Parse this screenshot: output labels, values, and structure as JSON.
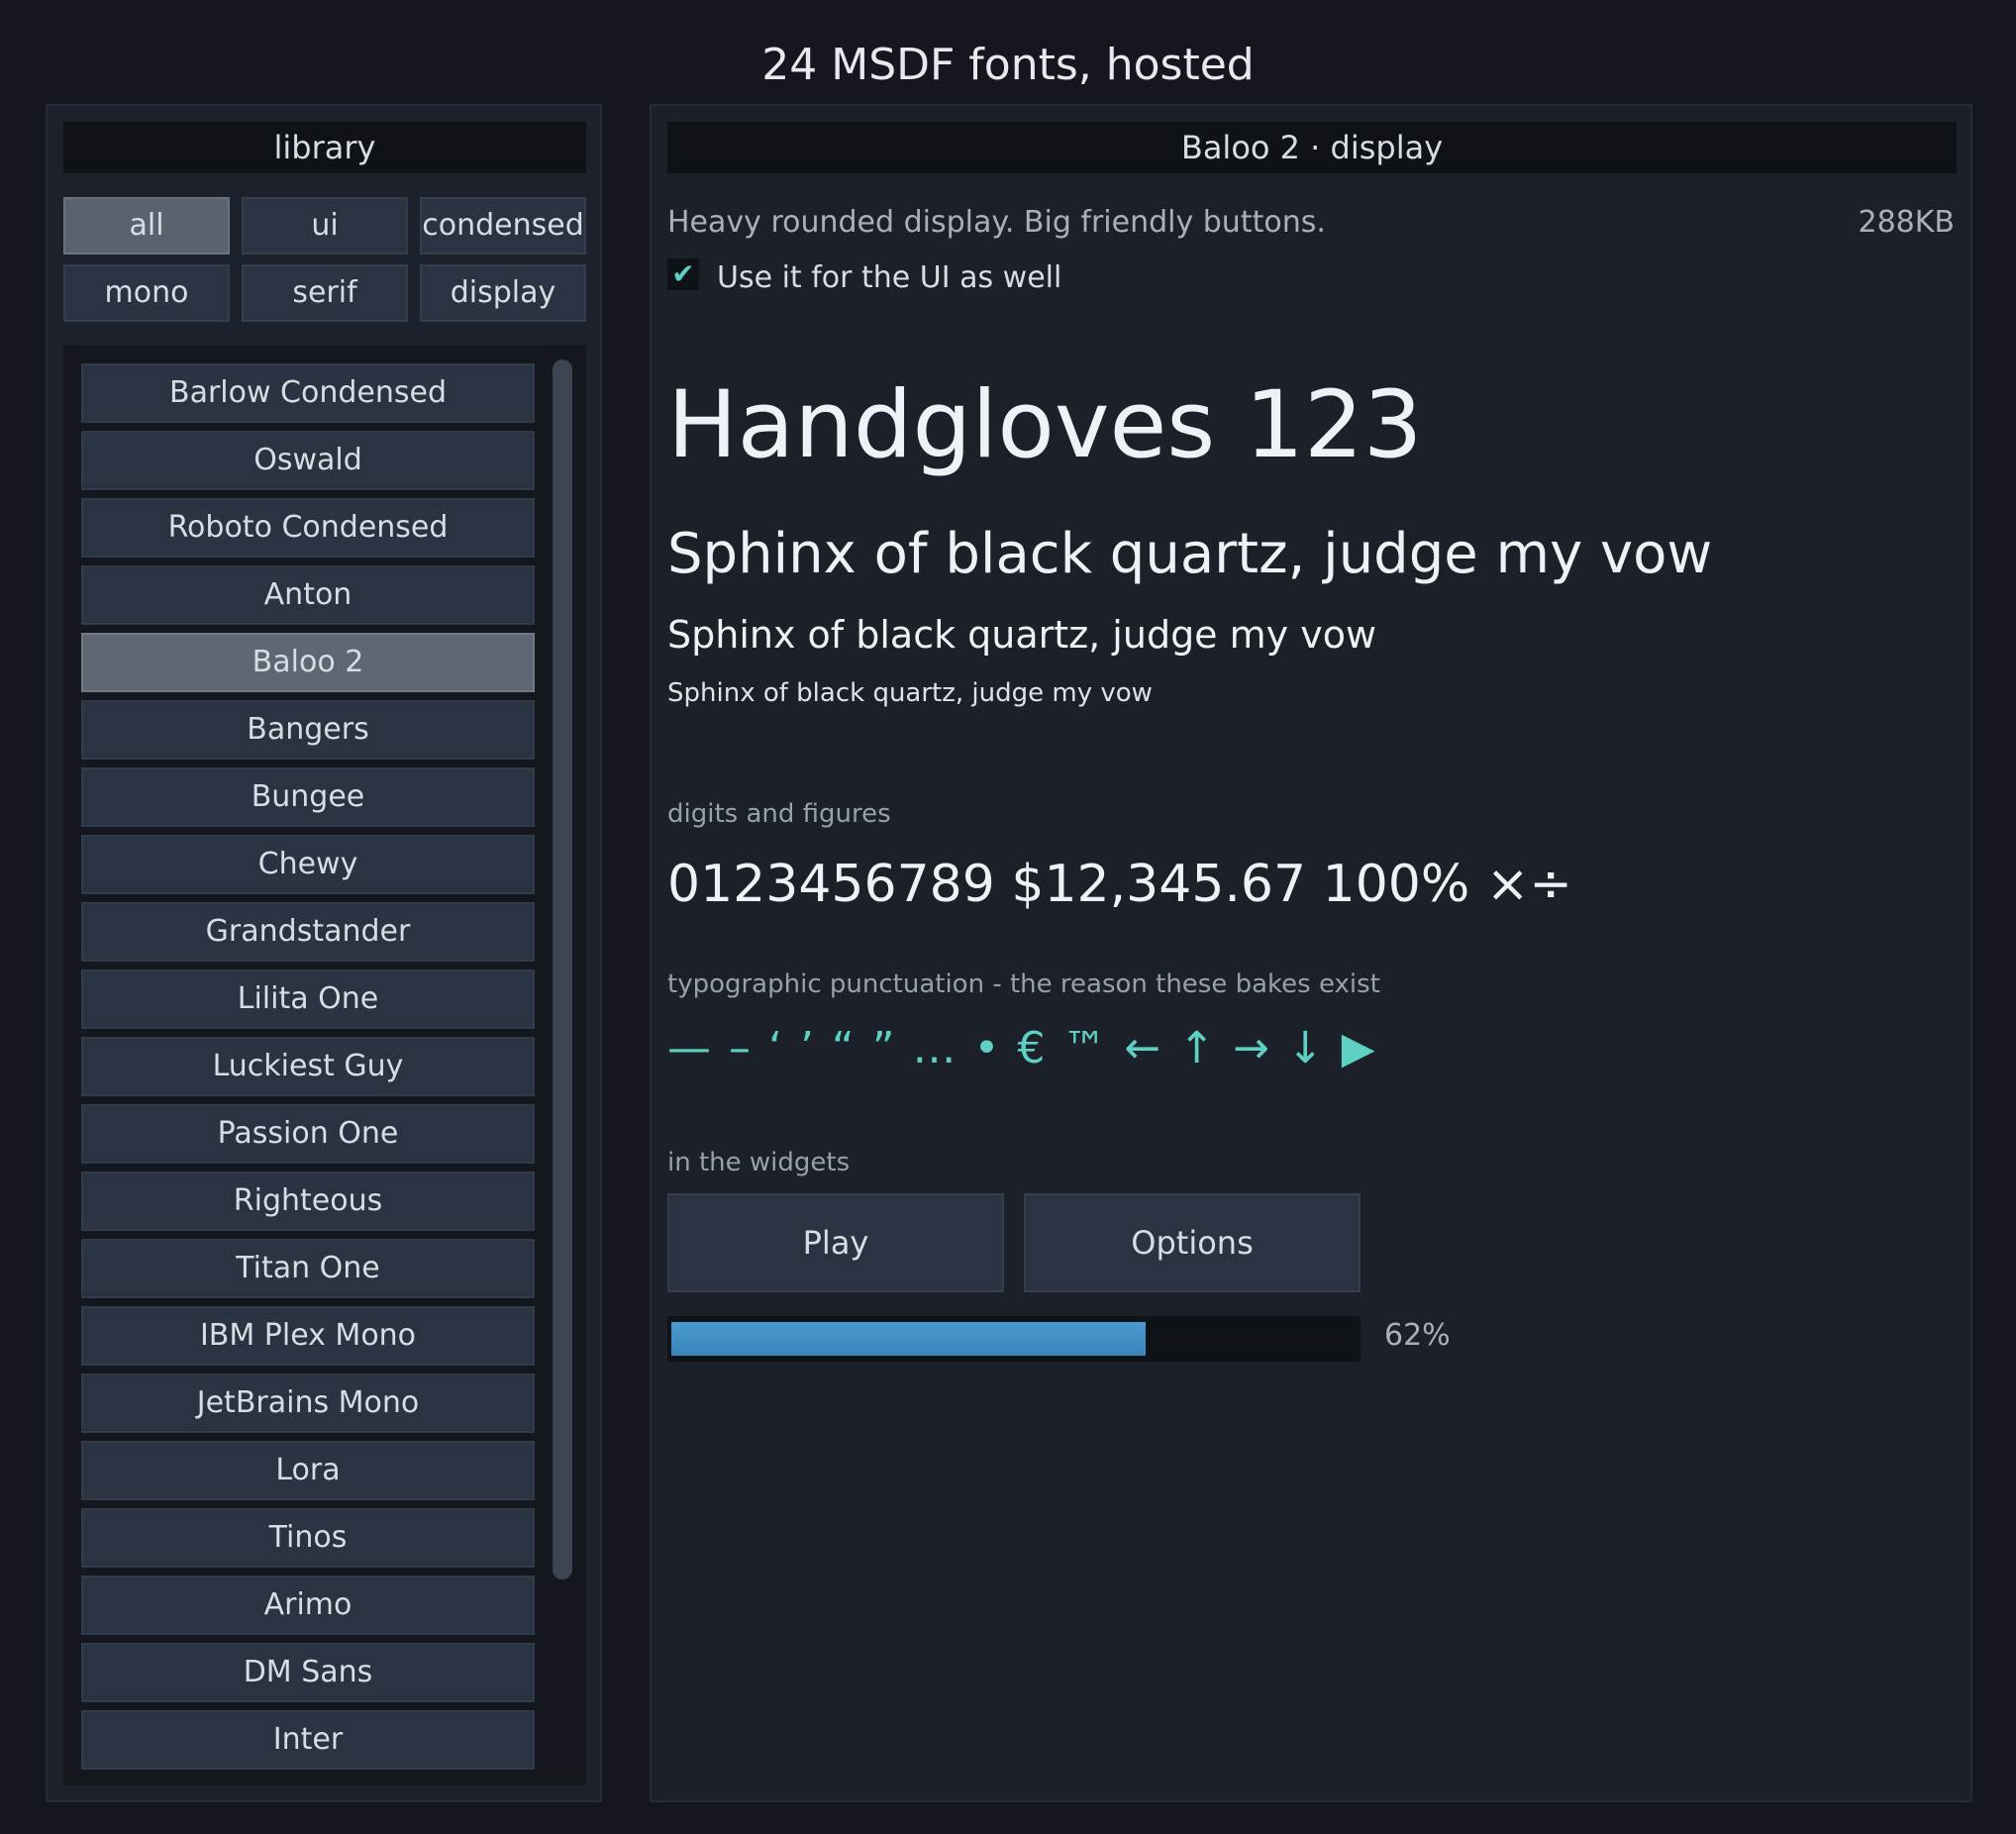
{
  "window": {
    "title": "24 MSDF fonts, hosted"
  },
  "library": {
    "header": "library",
    "filters": [
      {
        "label": "all",
        "active": true
      },
      {
        "label": "ui",
        "active": false
      },
      {
        "label": "condensed",
        "active": false
      },
      {
        "label": "mono",
        "active": false
      },
      {
        "label": "serif",
        "active": false
      },
      {
        "label": "display",
        "active": false
      }
    ],
    "fonts": [
      "Barlow Condensed",
      "Oswald",
      "Roboto Condensed",
      "Anton",
      "Baloo 2",
      "Bangers",
      "Bungee",
      "Chewy",
      "Grandstander",
      "Lilita One",
      "Luckiest Guy",
      "Passion One",
      "Righteous",
      "Titan One",
      "IBM Plex Mono",
      "JetBrains Mono",
      "Lora",
      "Tinos",
      "Arimo",
      "DM Sans",
      "Inter"
    ],
    "selected": "Baloo 2"
  },
  "detail": {
    "header": "Baloo 2 · display",
    "description": "Heavy rounded display. Big friendly buttons.",
    "size": "288KB",
    "checkbox": {
      "checked": true,
      "mark": "✔",
      "label": "Use it for the UI as well"
    },
    "sample_xl": "Handgloves 123",
    "sample_l": "Sphinx of black quartz, judge my vow",
    "sample_m": "Sphinx of black quartz, judge my vow",
    "sample_s": "Sphinx of black quartz, judge my vow",
    "digits_label": "digits and figures",
    "digits": "0123456789  $12,345.67  100%  ×÷",
    "punct_label": "typographic punctuation - the reason these bakes exist",
    "punct": "— – ‘ ’ “ ” … • € ™ ← ↑ → ↓  ▶",
    "widgets_label": "in the widgets",
    "play_label": "Play",
    "options_label": "Options",
    "progress": {
      "value": 0.62,
      "label": "62%"
    }
  },
  "colors": {
    "background": "#15171f",
    "accent": "#5ed0c4",
    "progress": "#3a84ba",
    "button": "#2a3342",
    "button_active": "#5f6774"
  },
  "icons": {
    "check": "check-icon",
    "play_triangle": "play-triangle-glyph"
  }
}
